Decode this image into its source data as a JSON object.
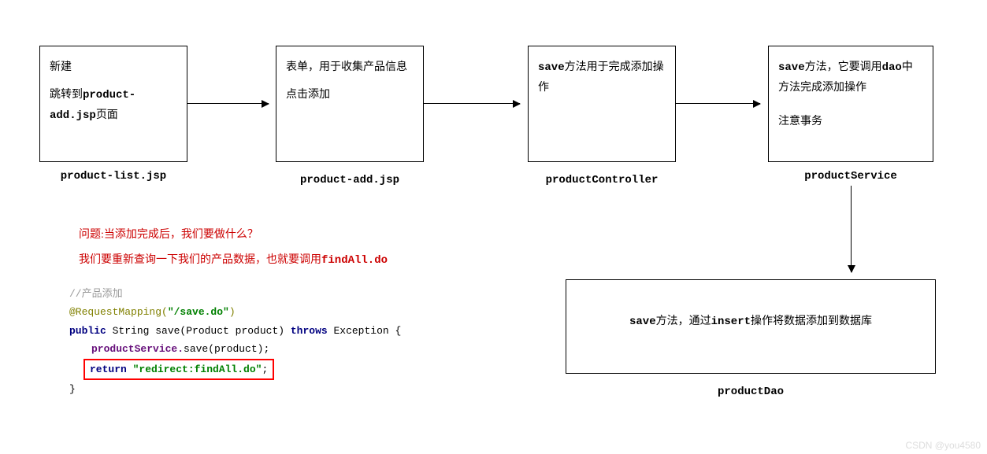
{
  "boxes": {
    "productList": {
      "line1": "新建",
      "line2_a": "跳转到",
      "line2_b": "product-add.jsp",
      "line2_c": "页面",
      "label": "product-list.jsp"
    },
    "productAdd": {
      "line1": "表单，用于收集产品信息",
      "line2": "点击添加",
      "label": "product-add.jsp"
    },
    "controller": {
      "line1_a": "save",
      "line1_b": "方法用于完成添加操作",
      "label": "productController"
    },
    "service": {
      "line1_a": "save",
      "line1_b": "方法，它要调用",
      "line1_c": "dao",
      "line1_d": "中方法完成添加操作",
      "line2": "注意事务",
      "label": "productService"
    },
    "dao": {
      "line1_a": "save",
      "line1_b": "方法，通过",
      "line1_c": "insert",
      "line1_d": "操作将数据添加到数据库",
      "label": "productDao"
    }
  },
  "note": {
    "line1": "问题:当添加完成后，我们要做什么？",
    "line2_a": "我们要重新查询一下我们的产品数据，也就要调用",
    "line2_b": "findAll.do"
  },
  "code": {
    "comment": "//产品添加",
    "anno_pre": "@RequestMapping(",
    "anno_str": "\"/save.do\"",
    "anno_post": ")",
    "sig_public": "public",
    "sig_mid": " String save(Product product) ",
    "sig_throws": "throws",
    "sig_post": " Exception {",
    "call_obj": "productService.",
    "call_rest": "save(product);",
    "ret_kw": "return ",
    "ret_str": "\"redirect:findAll.do\"",
    "ret_semi": ";",
    "close": "}"
  },
  "watermark": "CSDN @you4580"
}
